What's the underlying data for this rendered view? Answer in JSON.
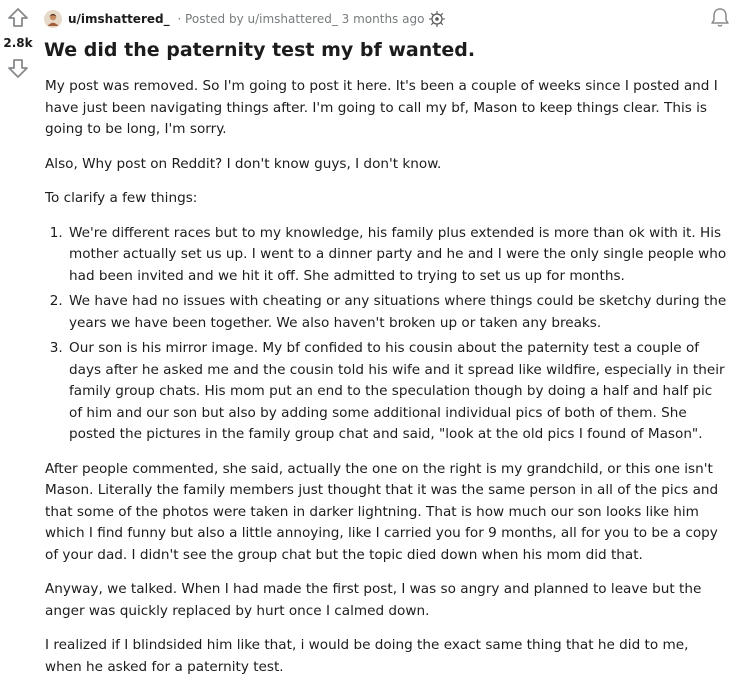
{
  "post": {
    "subreddit": "u/imshattered_",
    "meta": " · Posted by u/imshattered_ 3 months ago",
    "score": "2.8k",
    "title": "We did the paternity test my bf wanted.",
    "paragraphs_before": [
      "My post was removed. So I'm going to post it here. It's been a couple of weeks since I posted and I have just been navigating things after. I'm going to call my bf, Mason to keep things clear. This is going to be long, I'm sorry.",
      "Also, Why post on Reddit? I don't know guys, I don't know.",
      "To clarify a few things:"
    ],
    "list_items": [
      "We're different races but to my knowledge, his family plus extended is more than ok with it. His mother actually set us up. I went to a dinner party and he and I were the only single people who had been invited and we hit it off. She admitted to trying to set us up for months.",
      "We have had no issues with cheating or any situations where things could be sketchy during the years we have been together. We also haven't broken up or taken any breaks.",
      "Our son is his mirror image. My bf confided to his cousin about the paternity test a couple of days after he asked me and the cousin told his wife and it spread like wildfire, especially in their family group chats. His mom put an end to the speculation though by doing a half and half pic of him and our son but also by adding some additional individual pics of both of them. She posted the pictures in the family group chat and said, \"look at the old pics I found of Mason\"."
    ],
    "paragraphs_after": [
      "After people commented, she said, actually the one on the right is my grandchild, or this one isn't Mason. Literally the family members just thought that it was the same person in all of the pics and that some of the photos were taken in darker lightning. That is how much our son looks like him which I find funny but also a little annoying, like I carried you for 9 months, all for you to be a copy of your dad. I didn't see the group chat but the topic died down when his mom did that.",
      "Anyway, we talked. When I had made the first post, I was so angry and planned to leave but the anger was quickly replaced by hurt once I calmed down.",
      "I realized if I blindsided him like that, i would be doing the exact same thing that he did to me, when he asked for a paternity test."
    ]
  },
  "icons": {
    "upvote": "upvote-arrow-icon",
    "downvote": "downvote-arrow-icon",
    "avatar": "user-avatar",
    "award": "award-icon",
    "notification": "bell-icon"
  },
  "colors": {
    "text": "#1c1c1c",
    "meta": "#787c7e",
    "icon": "#878a8c"
  }
}
